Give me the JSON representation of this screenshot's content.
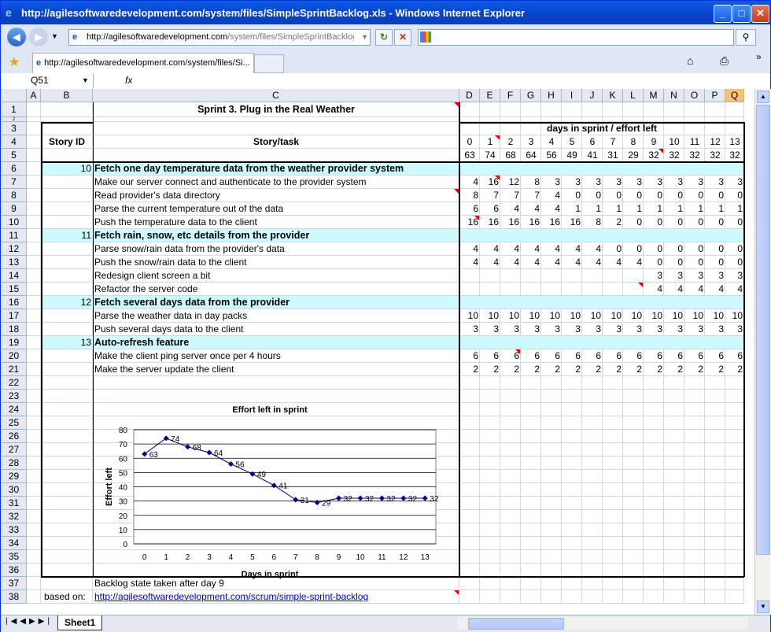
{
  "window": {
    "title": "http://agilesoftwaredevelopment.com/system/files/SimpleSprintBacklog.xls - Windows Internet Explorer",
    "address_prefix": "http://agilesoftwaredevelopment.com",
    "address_rest": "/system/files/SimpleSprintBacklog",
    "tab_title": "http://agilesoftwaredevelopment.com/system/files/Si..."
  },
  "excel": {
    "name_box": "Q51",
    "fx": "fx",
    "sheet_tab": "Sheet1",
    "col_headers": [
      "A",
      "B",
      "C",
      "D",
      "E",
      "F",
      "G",
      "H",
      "I",
      "J",
      "K",
      "L",
      "M",
      "N",
      "O",
      "P",
      "Q"
    ],
    "row_numbers": [
      "1",
      "2",
      "3",
      "4",
      "5",
      "6",
      "7",
      "8",
      "9",
      "10",
      "11",
      "12",
      "13",
      "14",
      "15",
      "16",
      "17",
      "18",
      "19",
      "20",
      "21",
      "22",
      "23",
      "24",
      "25",
      "26",
      "27",
      "28",
      "29",
      "30",
      "31",
      "32",
      "33",
      "34",
      "35",
      "36",
      "37",
      "38"
    ]
  },
  "sheet": {
    "title": "Sprint 3. Plug in the Real Weather",
    "days_header": "days in sprint / effort left",
    "story_id_header": "Story ID",
    "story_task_header": "Story/task",
    "days": [
      "0",
      "1",
      "2",
      "3",
      "4",
      "5",
      "6",
      "7",
      "8",
      "9",
      "10",
      "11",
      "12",
      "13"
    ],
    "effort_totals": [
      "63",
      "74",
      "68",
      "64",
      "56",
      "49",
      "41",
      "31",
      "29",
      "32",
      "32",
      "32",
      "32",
      "32"
    ],
    "rows": [
      {
        "id": "10",
        "task": "Fetch one day temperature data from the weather provider system",
        "story": true,
        "vals": []
      },
      {
        "id": "",
        "task": "Make our server connect and authenticate to the provider system",
        "story": false,
        "vals": [
          "4",
          "16",
          "12",
          "8",
          "3",
          "3",
          "3",
          "3",
          "3",
          "3",
          "3",
          "3",
          "3",
          "3"
        ]
      },
      {
        "id": "",
        "task": "Read provider's data directory",
        "story": false,
        "vals": [
          "8",
          "7",
          "7",
          "7",
          "4",
          "0",
          "0",
          "0",
          "0",
          "0",
          "0",
          "0",
          "0",
          "0"
        ]
      },
      {
        "id": "",
        "task": "Parse the current temperature out of the data",
        "story": false,
        "vals": [
          "6",
          "6",
          "4",
          "4",
          "4",
          "1",
          "1",
          "1",
          "1",
          "1",
          "1",
          "1",
          "1",
          "1"
        ]
      },
      {
        "id": "",
        "task": "Push the temperature data to the client",
        "story": false,
        "vals": [
          "16",
          "16",
          "16",
          "16",
          "16",
          "16",
          "8",
          "2",
          "0",
          "0",
          "0",
          "0",
          "0",
          "0"
        ]
      },
      {
        "id": "11",
        "task": "Fetch rain, snow, etc details from the provider",
        "story": true,
        "vals": []
      },
      {
        "id": "",
        "task": "Parse snow/rain data from the provider's data",
        "story": false,
        "vals": [
          "4",
          "4",
          "4",
          "4",
          "4",
          "4",
          "4",
          "0",
          "0",
          "0",
          "0",
          "0",
          "0",
          "0"
        ]
      },
      {
        "id": "",
        "task": "Push the snow/rain data to the client",
        "story": false,
        "vals": [
          "4",
          "4",
          "4",
          "4",
          "4",
          "4",
          "4",
          "4",
          "4",
          "0",
          "0",
          "0",
          "0",
          "0"
        ]
      },
      {
        "id": "",
        "task": "Redesign client screen a bit",
        "story": false,
        "vals": [
          "",
          "",
          "",
          "",
          "",
          "",
          "",
          "",
          "",
          "3",
          "3",
          "3",
          "3",
          "3"
        ]
      },
      {
        "id": "",
        "task": "Refactor the server code",
        "story": false,
        "vals": [
          "",
          "",
          "",
          "",
          "",
          "",
          "",
          "",
          "",
          "4",
          "4",
          "4",
          "4",
          "4"
        ]
      },
      {
        "id": "12",
        "task": "Fetch several days data from the provider",
        "story": true,
        "vals": []
      },
      {
        "id": "",
        "task": "Parse the weather data in day packs",
        "story": false,
        "vals": [
          "10",
          "10",
          "10",
          "10",
          "10",
          "10",
          "10",
          "10",
          "10",
          "10",
          "10",
          "10",
          "10",
          "10"
        ]
      },
      {
        "id": "",
        "task": "Push several days data to the client",
        "story": false,
        "vals": [
          "3",
          "3",
          "3",
          "3",
          "3",
          "3",
          "3",
          "3",
          "3",
          "3",
          "3",
          "3",
          "3",
          "3"
        ]
      },
      {
        "id": "13",
        "task": "Auto-refresh feature",
        "story": true,
        "vals": []
      },
      {
        "id": "",
        "task": "Make the client ping server once per 4 hours",
        "story": false,
        "vals": [
          "6",
          "6",
          "6",
          "6",
          "6",
          "6",
          "6",
          "6",
          "6",
          "6",
          "6",
          "6",
          "6",
          "6"
        ]
      },
      {
        "id": "",
        "task": "Make the server update the client",
        "story": false,
        "vals": [
          "2",
          "2",
          "2",
          "2",
          "2",
          "2",
          "2",
          "2",
          "2",
          "2",
          "2",
          "2",
          "2",
          "2"
        ]
      }
    ],
    "note": "Backlog state taken after day 9",
    "based_on_label": "based on:",
    "based_on_link": "http://agilesoftwaredevelopment.com/scrum/simple-sprint-backlog"
  },
  "chart_data": {
    "type": "line",
    "title": "Effort left in sprint",
    "xlabel": "Days in sprint",
    "ylabel": "Effort left",
    "x": [
      0,
      1,
      2,
      3,
      4,
      5,
      6,
      7,
      8,
      9,
      10,
      11,
      12,
      13
    ],
    "series": [
      {
        "values": [
          63,
          74,
          68,
          64,
          56,
          49,
          41,
          31,
          29,
          32,
          32,
          32,
          32,
          32
        ]
      }
    ],
    "ylim": [
      0,
      80
    ],
    "yticks": [
      "0",
      "10",
      "20",
      "30",
      "40",
      "50",
      "60",
      "70",
      "80"
    ],
    "xticks": [
      "0",
      "1",
      "2",
      "3",
      "4",
      "5",
      "6",
      "7",
      "8",
      "9",
      "10",
      "11",
      "12",
      "13"
    ],
    "grid": true,
    "color": "#000080"
  }
}
